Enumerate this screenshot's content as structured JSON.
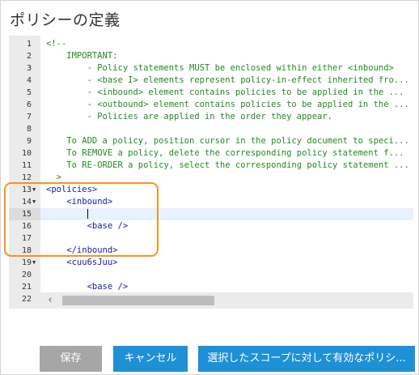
{
  "page": {
    "title": "ポリシーの定義"
  },
  "editor": {
    "lines": [
      {
        "num": "1",
        "fold": "",
        "parts": [
          {
            "t": "<!--",
            "c": "comment"
          }
        ]
      },
      {
        "num": "2",
        "fold": "",
        "parts": [
          {
            "t": "    IMPORTANT:",
            "c": "comment"
          }
        ]
      },
      {
        "num": "3",
        "fold": "",
        "parts": [
          {
            "t": "        - Policy statements MUST be enclosed within either <inbound>",
            "c": "comment"
          }
        ]
      },
      {
        "num": "4",
        "fold": "",
        "parts": [
          {
            "t": "        - <base I> elements represent policy-in-effect inherited fro...",
            "c": "comment"
          }
        ]
      },
      {
        "num": "5",
        "fold": "",
        "parts": [
          {
            "t": "        - <inbound> element contains policies to be applied in the ...",
            "c": "comment"
          }
        ]
      },
      {
        "num": "6",
        "fold": "",
        "parts": [
          {
            "t": "        - <outbound> element contains policies to be applied in the ...",
            "c": "comment"
          }
        ]
      },
      {
        "num": "7",
        "fold": "",
        "parts": [
          {
            "t": "        - Policies are applied in the order they appear.",
            "c": "comment"
          }
        ]
      },
      {
        "num": "8",
        "fold": "",
        "parts": []
      },
      {
        "num": "9",
        "fold": "",
        "parts": [
          {
            "t": "    To ADD a policy, position cursor in the policy document to speci...",
            "c": "comment"
          }
        ]
      },
      {
        "num": "10",
        "fold": "",
        "parts": [
          {
            "t": "    To REMOVE a policy, delete the corresponding policy statement f...",
            "c": "comment"
          }
        ]
      },
      {
        "num": "11",
        "fold": "",
        "parts": [
          {
            "t": "    To RE-ORDER a policy, select the corresponding policy statement ...",
            "c": "comment"
          }
        ]
      },
      {
        "num": "12",
        "fold": "",
        "parts": [
          {
            "t": "  >",
            "c": "comment"
          }
        ]
      },
      {
        "num": "13",
        "fold": "▼",
        "parts": [
          {
            "t": "<policies>",
            "c": "tag"
          }
        ]
      },
      {
        "num": "14",
        "fold": "▼",
        "parts": [
          {
            "t": "    <inbound>",
            "c": "tag"
          }
        ]
      },
      {
        "num": "15",
        "fold": "",
        "parts": [
          {
            "t": "        ",
            "c": "tag"
          }
        ],
        "active": true,
        "caret": true
      },
      {
        "num": "16",
        "fold": "",
        "parts": [
          {
            "t": "        <base />",
            "c": "tag"
          }
        ]
      },
      {
        "num": "17",
        "fold": "",
        "parts": []
      },
      {
        "num": "18",
        "fold": "",
        "parts": [
          {
            "t": "    </inbound>",
            "c": "tag"
          }
        ]
      },
      {
        "num": "19",
        "fold": "▼",
        "parts": [
          {
            "t": "    <cuu6sJuu>",
            "c": "tag"
          }
        ]
      },
      {
        "num": "20",
        "fold": "",
        "parts": []
      },
      {
        "num": "21",
        "fold": "",
        "parts": [
          {
            "t": "        <base />",
            "c": "tag"
          }
        ]
      },
      {
        "num": "22",
        "fold": "",
        "parts": []
      }
    ],
    "scroll_left_icon": "‹"
  },
  "buttons": {
    "save": "保存",
    "cancel": "キャンセル",
    "effective": "選択したスコープに対して有効なポリシ..."
  },
  "colors": {
    "accent": "#1e90d6",
    "disabled": "#a6a6a6",
    "highlight": "#f7941d",
    "comment": "#228b22",
    "tag": "#1a1aa6"
  }
}
